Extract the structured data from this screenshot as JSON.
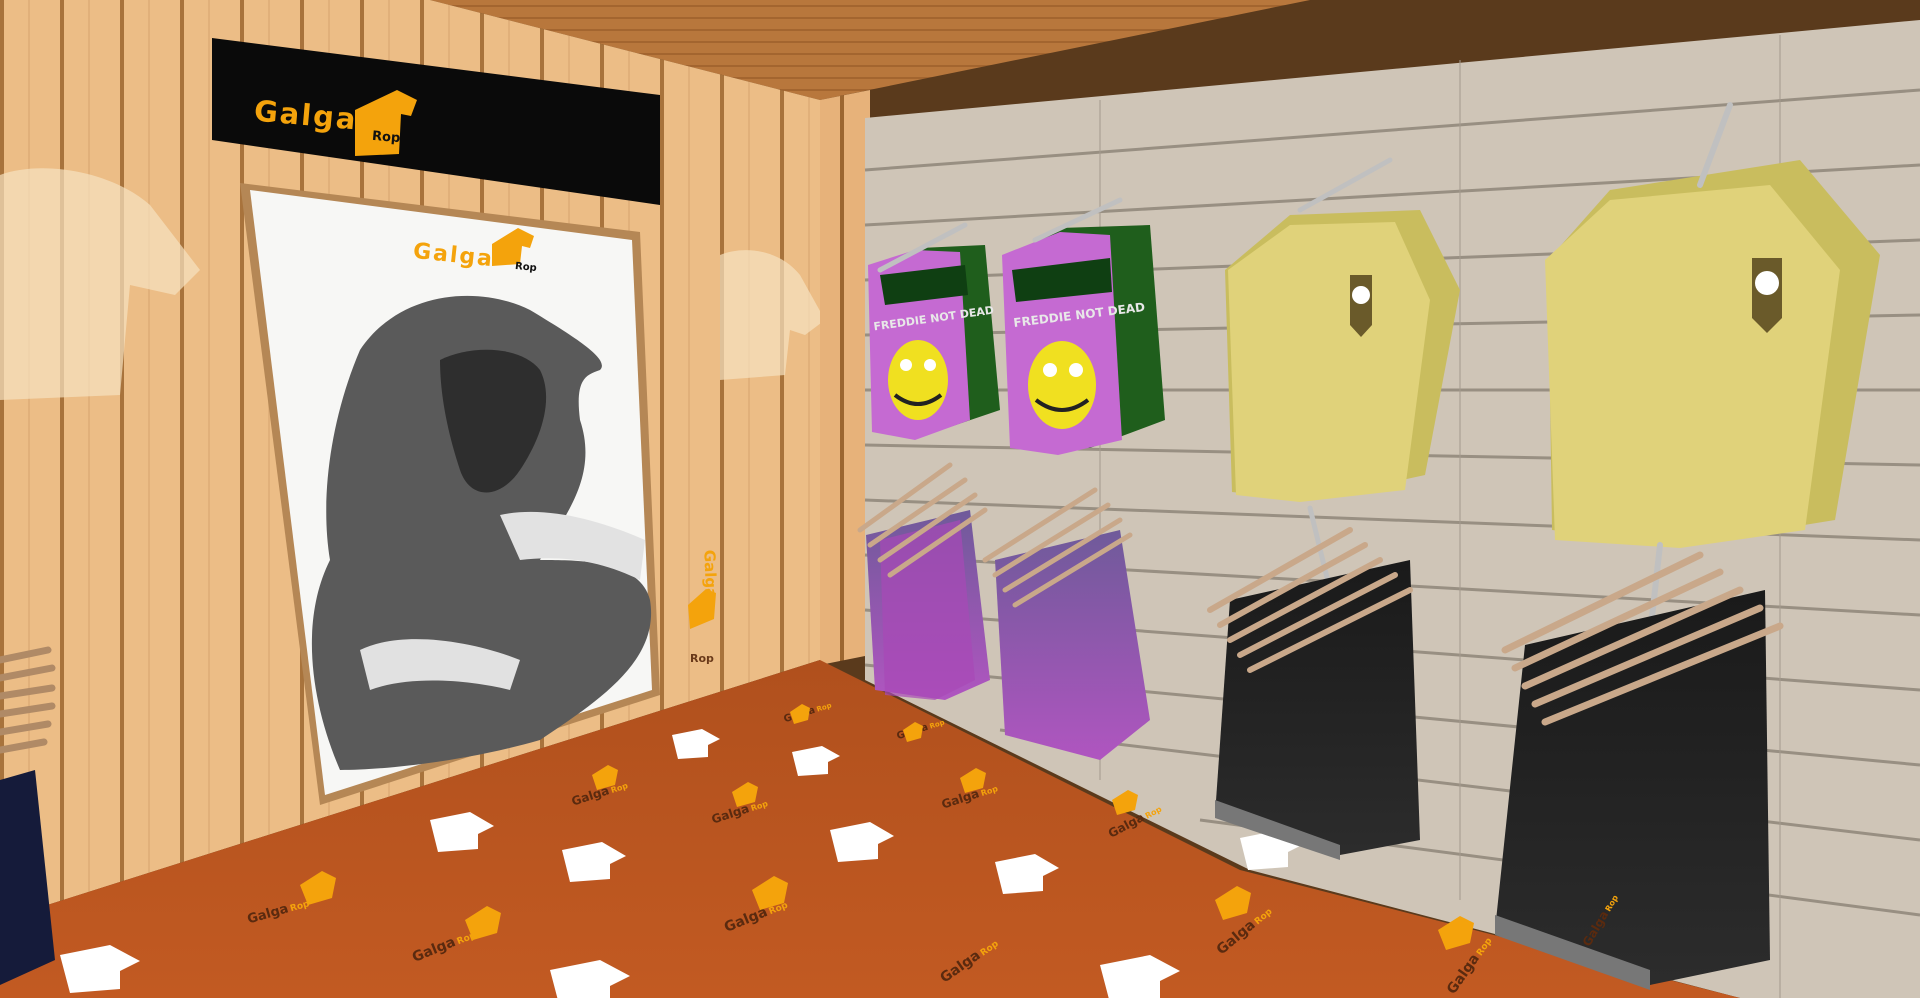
{
  "store": {
    "brand_word": "Galga",
    "brand_sub": "Rop",
    "colors": {
      "sign_bg": "#0a0a0a",
      "brand_orange": "#f4a30c",
      "floor": "#b8541f",
      "left_wall": "#e6b57f",
      "right_wall": "#cfc6b9",
      "ceiling": "#b97a3f"
    }
  },
  "poster": {
    "brand_word": "Galga",
    "brand_sub": "Rop",
    "side_word": "Galga",
    "side_sub": "Rop"
  },
  "racks": [
    {
      "name": "pink-shirts-1",
      "print": "FREDDIE NOT DEAD"
    },
    {
      "name": "pink-shirts-2",
      "print": "FREDDIE NOT DEAD"
    }
  ],
  "floor_logos": [
    {
      "word": "Galga",
      "sub": "Rop"
    },
    {
      "word": "Galga",
      "sub": "Rop"
    },
    {
      "word": "Galga",
      "sub": "Rop"
    },
    {
      "word": "Galga",
      "sub": "Rop"
    },
    {
      "word": "Galga",
      "sub": "Rop"
    },
    {
      "word": "Galga",
      "sub": "Rop"
    },
    {
      "word": "Galga",
      "sub": "Rop"
    },
    {
      "word": "Galga",
      "sub": "Rop"
    },
    {
      "word": "Galga",
      "sub": "Rop"
    },
    {
      "word": "Galga",
      "sub": "Rop"
    },
    {
      "word": "Galga",
      "sub": "Rop"
    },
    {
      "word": "Galga",
      "sub": "Rop"
    },
    {
      "word": "Galga",
      "sub": "Rop"
    }
  ]
}
